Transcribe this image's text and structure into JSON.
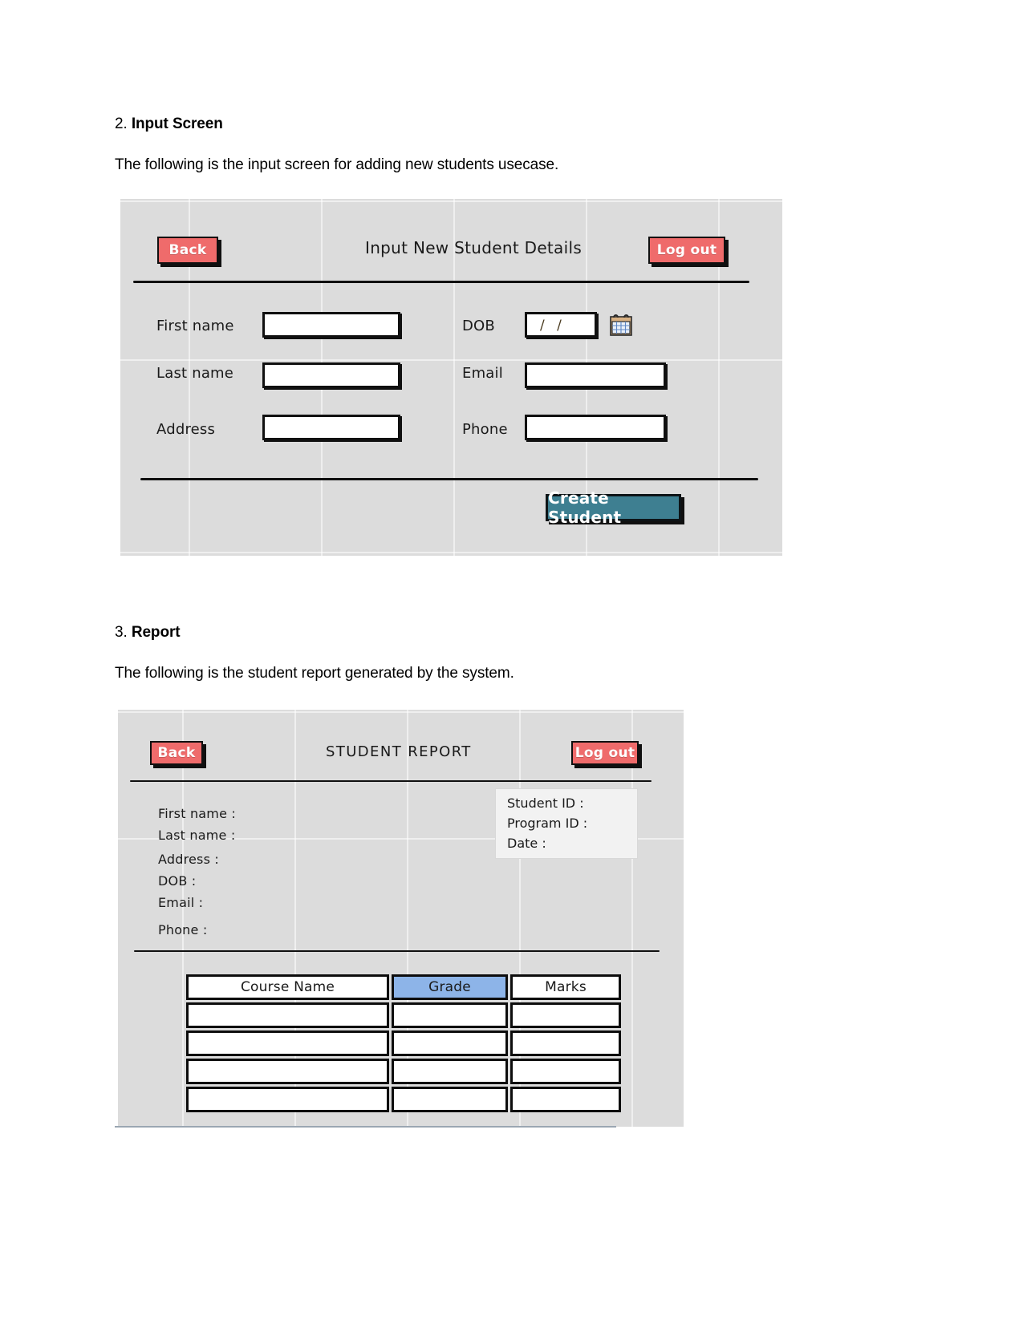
{
  "document": {
    "section2": {
      "number": "2.",
      "title": "Input Screen",
      "paragraph": "The following is the input screen for adding new students usecase."
    },
    "section3": {
      "number": "3.",
      "title": "Report",
      "paragraph": "The following is the student report generated by the system."
    }
  },
  "input_screen": {
    "title": "Input New Student Details",
    "back_label": "Back",
    "logout_label": "Log out",
    "labels": {
      "first_name": "First name",
      "last_name": "Last name",
      "address": "Address",
      "dob": "DOB",
      "email": "Email",
      "phone": "Phone"
    },
    "values": {
      "first_name": "",
      "last_name": "",
      "address": "",
      "dob": "/  /",
      "email": "",
      "phone": ""
    },
    "calendar_icon": "calendar-icon",
    "submit_label": "Create Student",
    "colors": {
      "screen_bg": "#dcdcdc",
      "button_red": "#ef6b6b",
      "button_teal": "#3e7f91",
      "outline": "#101010"
    }
  },
  "report_screen": {
    "title": "STUDENT REPORT",
    "back_label": "Back",
    "logout_label": "Log out",
    "details": [
      "First name :",
      "Last name :",
      "Address :",
      "DOB :",
      "Email :",
      "Phone :"
    ],
    "info_panel": [
      "Student ID :",
      "Program ID :",
      "Date :"
    ],
    "table": {
      "headers": [
        "Course Name",
        "Grade",
        "Marks"
      ],
      "rows": [
        [
          "",
          "",
          ""
        ],
        [
          "",
          "",
          ""
        ],
        [
          "",
          "",
          ""
        ],
        [
          "",
          "",
          ""
        ]
      ]
    },
    "colors": {
      "screen_bg": "#dcdcdc",
      "panel_bg": "#f2f2f2",
      "grade_header": "#8db4e8",
      "button_red": "#ef6b6b"
    }
  }
}
